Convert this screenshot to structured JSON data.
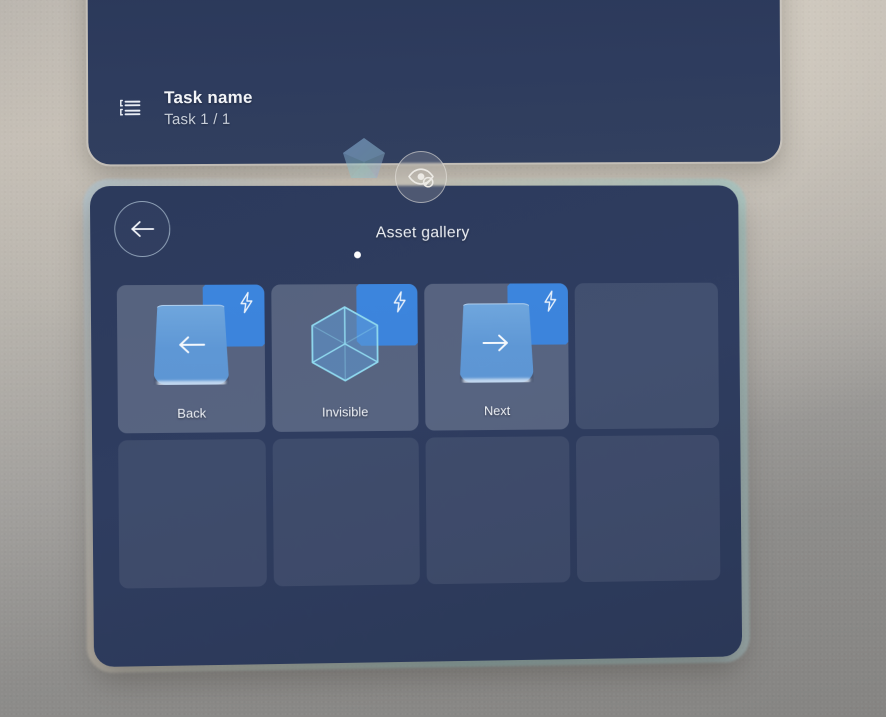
{
  "scene": {
    "background_top_color": "#cdc8c0",
    "background_bottom_color": "#8a8987",
    "panel_color": "#2e3c5e",
    "accent_color": "#3d86de"
  },
  "task_panel": {
    "icon": "task-list-icon",
    "title": "Task name",
    "subtitle": "Task 1 / 1"
  },
  "floating": {
    "handle_icon": "polygon-handle-icon",
    "visibility_toggle": {
      "icon": "eye-off-icon",
      "label": "Hide"
    }
  },
  "gallery": {
    "back_button": {
      "icon": "arrow-left-icon",
      "label": "Back"
    },
    "title": "Asset gallery",
    "page_dots": [
      {
        "active": true
      }
    ],
    "items": [
      {
        "label": "Back",
        "icon": "page-arrow-left-icon",
        "badge": "lightning-bolt-icon",
        "filled": true
      },
      {
        "label": "Invisible",
        "icon": "wireframe-cube-icon",
        "badge": "lightning-bolt-icon",
        "filled": true
      },
      {
        "label": "Next",
        "icon": "page-arrow-right-icon",
        "badge": "lightning-bolt-icon",
        "filled": true
      },
      {
        "label": "",
        "icon": "",
        "badge": "",
        "filled": false
      }
    ],
    "empty_slots_row2": 4
  }
}
